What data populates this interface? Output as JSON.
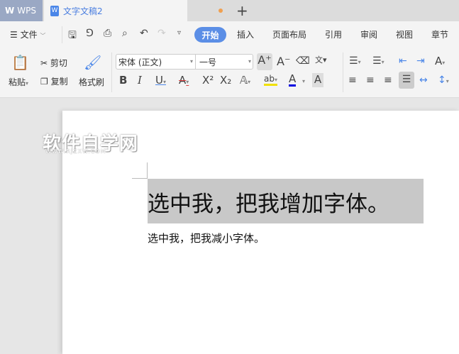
{
  "tabs": {
    "app": "WPS",
    "doc": "文字文稿2",
    "new_tab": "+"
  },
  "menu": {
    "file": "文件",
    "items": [
      "开始",
      "插入",
      "页面布局",
      "引用",
      "审阅",
      "视图",
      "章节"
    ]
  },
  "quick": [
    "save-icon",
    "format-icon",
    "print-icon",
    "preview-icon",
    "undo-icon",
    "redo-icon",
    "more-icon"
  ],
  "clipboard": {
    "paste": "粘贴",
    "cut": "剪切",
    "copy": "复制",
    "format_painter": "格式刷"
  },
  "font": {
    "name": "宋体 (正文)",
    "size": "一号"
  },
  "document": {
    "line1": "选中我，把我增加字体。",
    "line2": "选中我，把我减小字体。"
  },
  "watermark": {
    "title": "软件自学网",
    "url": "WWW.RJZXW.COM"
  },
  "colors": {
    "accent": "#5b8ee6",
    "highlight": "#c8c8c8"
  }
}
